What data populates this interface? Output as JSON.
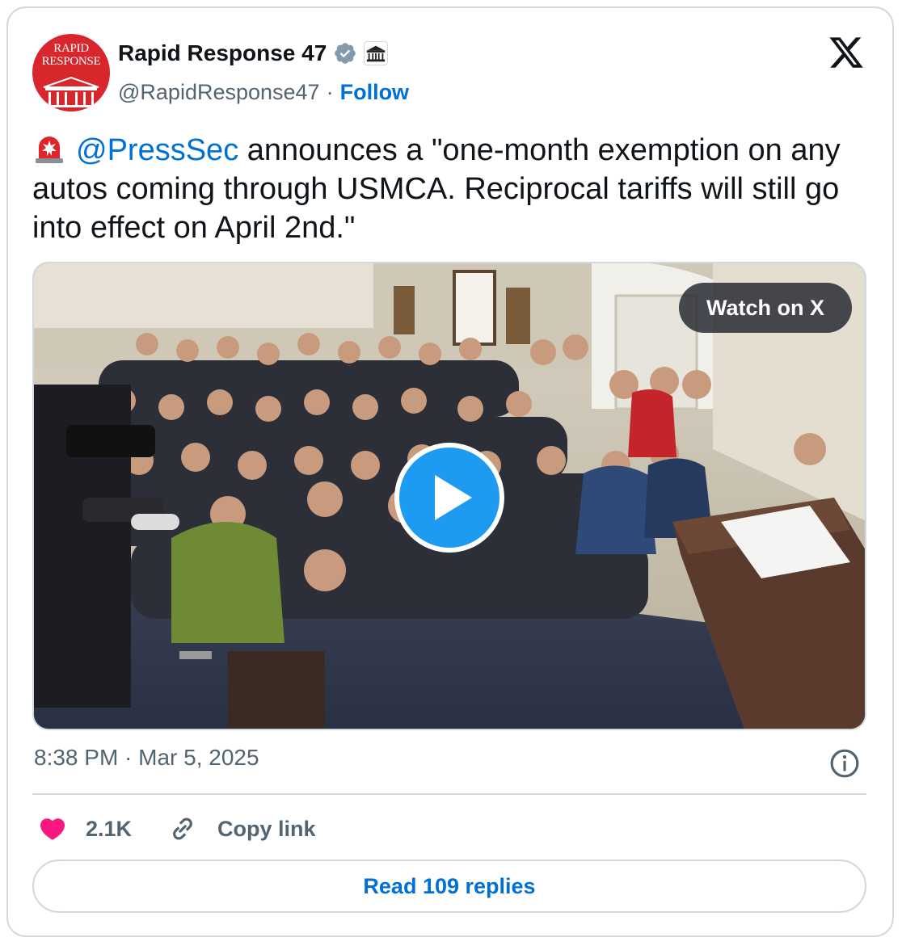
{
  "author": {
    "avatar_text": [
      "RAPID",
      "RESPONSE"
    ],
    "display_name": "Rapid Response 47",
    "handle": "@RapidResponse47",
    "separator": "·",
    "follow_label": "Follow",
    "verified_icon": "verified-badge-icon",
    "affiliation_icon": "white-house-icon"
  },
  "tweet": {
    "emoji": "rotating-light-icon",
    "mention": "@PressSec",
    "text": " announces a \"one-month exemption on any autos coming through USMCA. Reciprocal tariffs will still go into effect on April 2nd.\""
  },
  "media": {
    "watch_label": "Watch on X",
    "play_icon": "play-icon"
  },
  "meta": {
    "timestamp": "8:38 PM · Mar 5, 2025",
    "info_icon": "info-icon"
  },
  "actions": {
    "likes": "2.1K",
    "copy_link": "Copy link"
  },
  "replies_button": "Read 109 replies",
  "colors": {
    "link_blue": "#006fd6",
    "play_blue": "#1d9bf0",
    "heart": "#f91880",
    "muted": "#536471",
    "avatar_red": "#d7262c"
  }
}
